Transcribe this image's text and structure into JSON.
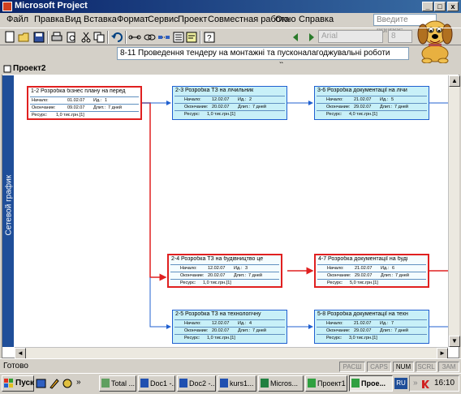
{
  "window": {
    "title": "Microsoft Project",
    "minimize": "_",
    "restore": "□",
    "close": "x"
  },
  "menu": [
    "Файл",
    "Правка",
    "Вид",
    "Вставка",
    "Формат",
    "Сервис",
    "Проект",
    "Совместная работа",
    "Окно",
    "Справка"
  ],
  "help_box": {
    "placeholder": "Введите вопрос"
  },
  "toolbar": {
    "font": "Arial",
    "size": "8",
    "more": "»"
  },
  "entry_bar": {
    "value": "8-11 Проведення тендеру на монтажні та пусконалагоджувальні роботи"
  },
  "project_window": {
    "title": "Проект2",
    "view_label": "Сетевой график"
  },
  "labels": {
    "start": "Начало:",
    "id": "Ид.:",
    "finish": "Окончание:",
    "duration": "Длит.:",
    "resource": "Ресурс:"
  },
  "nodes": [
    {
      "title": "1-2 Розробка бізнес плану на перед",
      "start": "01.02.07",
      "id": "1",
      "finish": "09.02.07",
      "duration": "7 дней",
      "resource": "1,0 тис.грн.[1]",
      "critical": true
    },
    {
      "title": "2-3 Розробка ТЗ на лічильник",
      "start": "12.02.07",
      "id": "2",
      "finish": "20.02.07",
      "duration": "7 дней",
      "resource": "1,0 тис.грн.[1]",
      "critical": false
    },
    {
      "title": "3-6 Розробка документації на лічи",
      "start": "21.02.07",
      "id": "5",
      "finish": "29.02.07",
      "duration": "7 дней",
      "resource": "4,0 тис.грн.[1]",
      "critical": false
    },
    {
      "title": "2-4 Розробка ТЗ на будівництво це",
      "start": "12.02.07",
      "id": "3",
      "finish": "20.02.07",
      "duration": "7 дней",
      "resource": "1,0 тис.грн.[1]",
      "critical": true
    },
    {
      "title": "4-7 Розробка документації на буді",
      "start": "21.02.07",
      "id": "6",
      "finish": "29.02.07",
      "duration": "7 дней",
      "resource": "5,0 тис.грн.[1]",
      "critical": true
    },
    {
      "title": "2-5 Розробка ТЗ на технологічну",
      "start": "12.02.07",
      "id": "4",
      "finish": "20.02.07",
      "duration": "7 дней",
      "resource": "1,0 тис.грн.[1]",
      "critical": false
    },
    {
      "title": "5-8 Розробка документації на техн",
      "start": "21.02.07",
      "id": "7",
      "finish": "29.02.07",
      "duration": "7 дней",
      "resource": "3,0 тис.грн.[1]",
      "critical": false
    }
  ],
  "status": {
    "text": "Готово",
    "indicators": [
      {
        "label": "РАСШ",
        "on": false
      },
      {
        "label": "CAPS",
        "on": false
      },
      {
        "label": "NUM",
        "on": true
      },
      {
        "label": "SCRL",
        "on": false
      },
      {
        "label": "ЗАМ",
        "on": false
      }
    ]
  },
  "taskbar": {
    "start": "Пуск",
    "tasks": [
      "Total ...",
      "Doc1 -...",
      "Doc2 -...",
      "kurs1...",
      "Micros...",
      "Проект1",
      "Прое..."
    ],
    "active_index": 6,
    "lang": "RU",
    "time": "16:10"
  },
  "colors": {
    "critical": "#e02020",
    "normal": "#2060d0",
    "node_fill": "#c8f0f8",
    "sidebar": "#1f4e99"
  }
}
